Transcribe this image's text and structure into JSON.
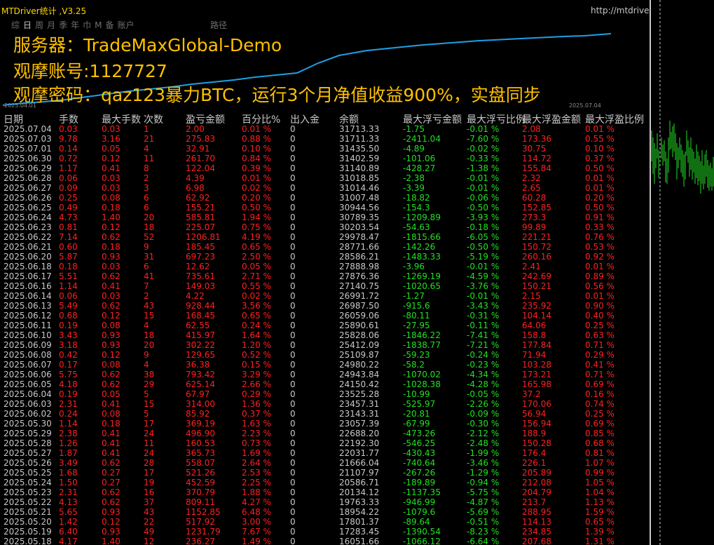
{
  "window": {
    "title": "MTDriver统计 ,V3.25",
    "url": "http://mtdriver.cn"
  },
  "periods": {
    "tabs": [
      "综",
      "日",
      "周",
      "月",
      "季",
      "年",
      "巾",
      "M",
      "备",
      "账户"
    ],
    "selected": "日",
    "route": "路径"
  },
  "overlay": {
    "line1": "服务器：TradeMaxGlobal-Demo",
    "line2": "观摩账号:1127727",
    "line3": "观摩密码：qaz123暴力BTC，运行3个月净值收益900%，实盘同步"
  },
  "chart": {
    "start_date": "2025.04.01",
    "end_date": "2025.07.04",
    "line_color": "#1ea0e6"
  },
  "colors": {
    "positive": "#ff2020",
    "negative": "#22e022",
    "accent": "#ffc000"
  },
  "table": {
    "headers": [
      "日期",
      "手数",
      "最大手数",
      "次数",
      "盈亏金额",
      "百分比%",
      "出入金",
      "余额",
      "最大浮亏金额",
      "最大浮亏比例",
      "最大浮盈金额",
      "最大浮盈比例"
    ],
    "rows": [
      [
        "2025.07.04",
        "0.03",
        "0.03",
        "1",
        "2.00",
        "0.01 %",
        "0",
        "31713.33",
        "-1.75",
        "-0.01 %",
        "2.08",
        "0.01 %"
      ],
      [
        "2025.07.03",
        "9.78",
        "3.16",
        "21",
        "275.83",
        "0.88 %",
        "0",
        "31711.33",
        "-2411.04",
        "-7.60 %",
        "173.36",
        "0.55 %"
      ],
      [
        "2025.07.01",
        "0.14",
        "0.05",
        "4",
        "32.91",
        "0.10 %",
        "0",
        "31435.50",
        "-4.89",
        "-0.02 %",
        "30.75",
        "0.10 %"
      ],
      [
        "2025.06.30",
        "0.72",
        "0.12",
        "11",
        "261.70",
        "0.84 %",
        "0",
        "31402.59",
        "-101.06",
        "-0.33 %",
        "114.72",
        "0.37 %"
      ],
      [
        "2025.06.29",
        "1.17",
        "0.41",
        "8",
        "122.04",
        "0.39 %",
        "0",
        "31140.89",
        "-428.27",
        "-1.38 %",
        "155.84",
        "0.50 %"
      ],
      [
        "2025.06.28",
        "0.06",
        "0.03",
        "2",
        "4.39",
        "0.01 %",
        "0",
        "31018.85",
        "-2.38",
        "-0.01 %",
        "2.32",
        "0.01 %"
      ],
      [
        "2025.06.27",
        "0.09",
        "0.03",
        "3",
        "6.98",
        "0.02 %",
        "0",
        "31014.46",
        "-3.39",
        "-0.01 %",
        "2.65",
        "0.01 %"
      ],
      [
        "2025.06.26",
        "0.25",
        "0.08",
        "6",
        "62.92",
        "0.20 %",
        "0",
        "31007.48",
        "-18.82",
        "-0.06 %",
        "60.28",
        "0.20 %"
      ],
      [
        "2025.06.25",
        "0.49",
        "0.18",
        "6",
        "155.21",
        "0.50 %",
        "0",
        "30944.56",
        "-154.3",
        "-0.50 %",
        "152.85",
        "0.50 %"
      ],
      [
        "2025.06.24",
        "4.73",
        "1.40",
        "20",
        "585.81",
        "1.94 %",
        "0",
        "30789.35",
        "-1209.89",
        "-3.93 %",
        "273.3",
        "0.91 %"
      ],
      [
        "2025.06.23",
        "0.81",
        "0.12",
        "18",
        "225.07",
        "0.75 %",
        "0",
        "30203.54",
        "-54.63",
        "-0.18 %",
        "99.89",
        "0.33 %"
      ],
      [
        "2025.06.22",
        "7.14",
        "0.62",
        "52",
        "1206.81",
        "4.19 %",
        "0",
        "29978.47",
        "-1815.66",
        "-6.05 %",
        "221.21",
        "0.76 %"
      ],
      [
        "2025.06.21",
        "0.60",
        "0.18",
        "9",
        "185.45",
        "0.65 %",
        "0",
        "28771.66",
        "-142.26",
        "-0.50 %",
        "150.72",
        "0.53 %"
      ],
      [
        "2025.06.20",
        "5.87",
        "0.93",
        "31",
        "697.23",
        "2.50 %",
        "0",
        "28586.21",
        "-1483.33",
        "-5.19 %",
        "260.16",
        "0.92 %"
      ],
      [
        "2025.06.18",
        "0.18",
        "0.03",
        "6",
        "12.62",
        "0.05 %",
        "0",
        "27888.98",
        "-3.96",
        "-0.01 %",
        "2.41",
        "0.01 %"
      ],
      [
        "2025.06.17",
        "5.51",
        "0.62",
        "41",
        "735.61",
        "2.71 %",
        "0",
        "27876.36",
        "-1269.19",
        "-4.59 %",
        "242.69",
        "0.89 %"
      ],
      [
        "2025.06.16",
        "1.14",
        "0.41",
        "7",
        "149.03",
        "0.55 %",
        "0",
        "27140.75",
        "-1020.65",
        "-3.76 %",
        "150.21",
        "0.56 %"
      ],
      [
        "2025.06.14",
        "0.06",
        "0.03",
        "2",
        "4.22",
        "0.02 %",
        "0",
        "26991.72",
        "-1.27",
        "-0.01 %",
        "2.15",
        "0.01 %"
      ],
      [
        "2025.06.13",
        "5.49",
        "0.62",
        "43",
        "928.44",
        "3.56 %",
        "0",
        "26987.50",
        "-915.6",
        "-3.43 %",
        "235.92",
        "0.90 %"
      ],
      [
        "2025.06.12",
        "0.68",
        "0.12",
        "15",
        "168.45",
        "0.65 %",
        "0",
        "26059.06",
        "-80.11",
        "-0.31 %",
        "104.14",
        "0.40 %"
      ],
      [
        "2025.06.11",
        "0.19",
        "0.08",
        "4",
        "62.55",
        "0.24 %",
        "0",
        "25890.61",
        "-27.95",
        "-0.11 %",
        "64.06",
        "0.25 %"
      ],
      [
        "2025.06.10",
        "3.43",
        "0.93",
        "18",
        "415.97",
        "1.64 %",
        "0",
        "25828.06",
        "-1846.22",
        "-7.41 %",
        "158.8",
        "0.63 %"
      ],
      [
        "2025.06.09",
        "3.18",
        "0.93",
        "20",
        "302.22",
        "1.20 %",
        "0",
        "25412.09",
        "-1838.77",
        "-7.21 %",
        "177.84",
        "0.71 %"
      ],
      [
        "2025.06.08",
        "0.42",
        "0.12",
        "9",
        "129.65",
        "0.52 %",
        "0",
        "25109.87",
        "-59.23",
        "-0.24 %",
        "71.94",
        "0.29 %"
      ],
      [
        "2025.06.07",
        "0.17",
        "0.08",
        "4",
        "36.38",
        "0.15 %",
        "0",
        "24980.22",
        "-58.2",
        "-0.23 %",
        "103.28",
        "0.41 %"
      ],
      [
        "2025.06.06",
        "5.75",
        "0.62",
        "38",
        "793.42",
        "3.29 %",
        "0",
        "24943.84",
        "-1070.02",
        "-4.34 %",
        "173.21",
        "0.71 %"
      ],
      [
        "2025.06.05",
        "4.18",
        "0.62",
        "29",
        "625.14",
        "2.66 %",
        "0",
        "24150.42",
        "-1028.38",
        "-4.28 %",
        "165.98",
        "0.69 %"
      ],
      [
        "2025.06.04",
        "0.19",
        "0.05",
        "5",
        "67.97",
        "0.29 %",
        "0",
        "23525.28",
        "-10.99",
        "-0.05 %",
        "37.2",
        "0.16 %"
      ],
      [
        "2025.06.03",
        "2.31",
        "0.41",
        "15",
        "314.00",
        "1.36 %",
        "0",
        "23457.31",
        "-525.97",
        "-2.26 %",
        "170.06",
        "0.74 %"
      ],
      [
        "2025.06.02",
        "0.24",
        "0.08",
        "5",
        "85.92",
        "0.37 %",
        "0",
        "23143.31",
        "-20.81",
        "-0.09 %",
        "56.94",
        "0.25 %"
      ],
      [
        "2025.05.30",
        "1.14",
        "0.18",
        "17",
        "369.19",
        "1.63 %",
        "0",
        "23057.39",
        "-67.99",
        "-0.30 %",
        "156.94",
        "0.69 %"
      ],
      [
        "2025.05.29",
        "2.38",
        "0.41",
        "24",
        "496.90",
        "2.23 %",
        "0",
        "22688.20",
        "-473.26",
        "-2.12 %",
        "188.9",
        "0.85 %"
      ],
      [
        "2025.05.28",
        "1.26",
        "0.41",
        "11",
        "160.53",
        "0.73 %",
        "0",
        "22192.30",
        "-546.25",
        "-2.48 %",
        "150.28",
        "0.68 %"
      ],
      [
        "2025.05.27",
        "1.87",
        "0.41",
        "24",
        "365.73",
        "1.69 %",
        "0",
        "22031.77",
        "-430.43",
        "-1.99 %",
        "176.4",
        "0.81 %"
      ],
      [
        "2025.05.26",
        "3.49",
        "0.62",
        "28",
        "558.07",
        "2.64 %",
        "0",
        "21666.04",
        "-740.64",
        "-3.46 %",
        "226.1",
        "1.07 %"
      ],
      [
        "2025.05.25",
        "1.68",
        "0.27",
        "17",
        "521.26",
        "2.53 %",
        "0",
        "21107.97",
        "-267.26",
        "-1.29 %",
        "205.89",
        "0.99 %"
      ],
      [
        "2025.05.24",
        "1.50",
        "0.27",
        "19",
        "452.59",
        "2.25 %",
        "0",
        "20586.71",
        "-189.89",
        "-0.94 %",
        "212.08",
        "1.05 %"
      ],
      [
        "2025.05.23",
        "2.31",
        "0.62",
        "16",
        "370.79",
        "1.88 %",
        "0",
        "20134.12",
        "-1137.35",
        "-5.75 %",
        "204.79",
        "1.04 %"
      ],
      [
        "2025.05.22",
        "4.13",
        "0.62",
        "37",
        "809.11",
        "4.27 %",
        "0",
        "19763.33",
        "-946.99",
        "-4.87 %",
        "213.7",
        "1.13 %"
      ],
      [
        "2025.05.21",
        "5.65",
        "0.93",
        "43",
        "1152.85",
        "6.48 %",
        "0",
        "18954.22",
        "-1079.6",
        "-5.69 %",
        "288.95",
        "1.59 %"
      ],
      [
        "2025.05.20",
        "1.42",
        "0.12",
        "22",
        "517.92",
        "3.00 %",
        "0",
        "17801.37",
        "-89.64",
        "-0.51 %",
        "114.13",
        "0.65 %"
      ],
      [
        "2025.05.19",
        "6.40",
        "0.93",
        "49",
        "1231.79",
        "7.67 %",
        "0",
        "17283.45",
        "-1390.54",
        "-8.23 %",
        "234.85",
        "1.39 %"
      ],
      [
        "2025.05.18",
        "4.17",
        "1.40",
        "12",
        "236.27",
        "1.49 %",
        "0",
        "16051.66",
        "-1066.12",
        "-6.64 %",
        "207.68",
        "1.31 %"
      ]
    ]
  }
}
